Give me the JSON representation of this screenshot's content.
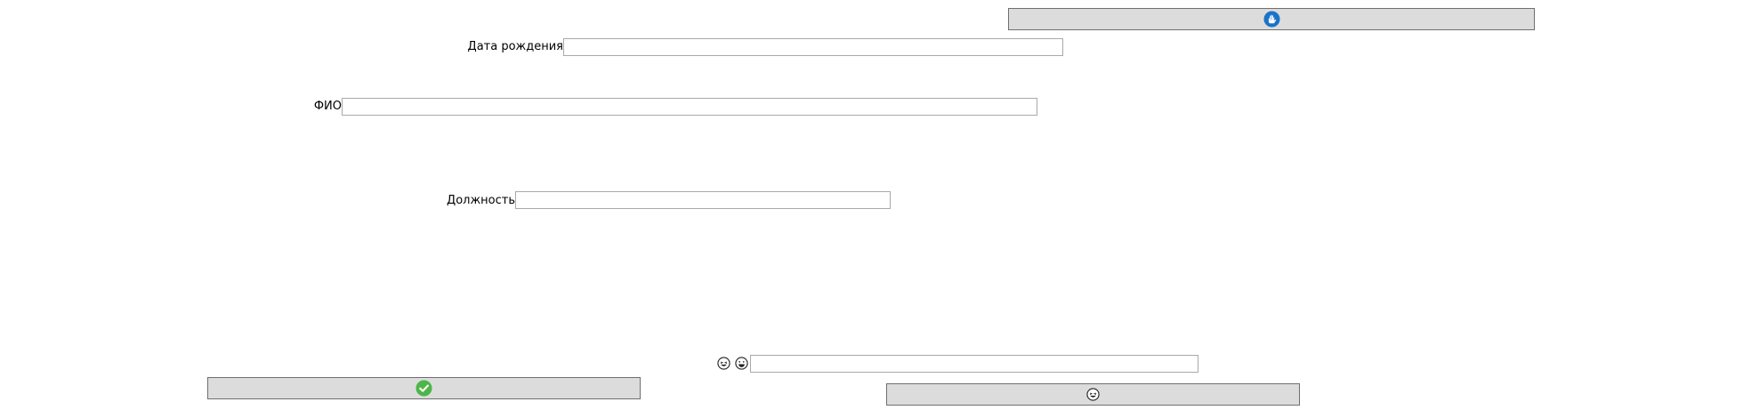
{
  "top_button": {
    "icon": "hand-icon",
    "icon_color": "#1b73c8"
  },
  "fields": {
    "birth_date": {
      "label": "Дата рождения",
      "value": ""
    },
    "full_name": {
      "label": "ФИО",
      "value": ""
    },
    "position": {
      "label": "Должность",
      "value": ""
    },
    "emoji_input": {
      "value": "",
      "icons": [
        "laughing-face-icon",
        "grinning-face-icon"
      ]
    }
  },
  "confirm_button": {
    "icon": "checkmark-icon",
    "icon_color": "#4cb648"
  },
  "emoji_button": {
    "icon": "laughing-face-icon"
  }
}
